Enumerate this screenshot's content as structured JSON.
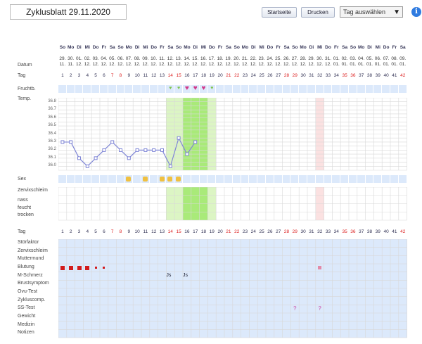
{
  "header": {
    "title": "Zyklusblatt 29.11.2020",
    "buttons": [
      "Startseite",
      "Drucken"
    ],
    "select_value": "Tag auswählen",
    "info_glyph": "i"
  },
  "labels": {
    "datum": "Datum",
    "tag": "Tag",
    "frucht": "Fruchtb.",
    "temp": "Temp.",
    "sex": "Sex",
    "zervix": "Zervixschleim",
    "zervix_levels": [
      "nass",
      "feucht",
      "trocken"
    ],
    "tag2": "Tag"
  },
  "temp_axis": [
    "36.8",
    "36.7",
    "36.6",
    "36.5",
    "36.4",
    "36.3",
    "36.2",
    "36.1",
    "36.0"
  ],
  "weekdays": [
    "So",
    "Mo",
    "Di",
    "Mi",
    "Do",
    "Fr",
    "Sa",
    "So",
    "Mo",
    "Di",
    "Mi",
    "Do",
    "Fr",
    "Sa",
    "So",
    "Mo",
    "Di",
    "Mi",
    "Do",
    "Fr",
    "Sa",
    "So",
    "Mo",
    "Di",
    "Mi",
    "Do",
    "Fr",
    "Sa",
    "So",
    "Mo",
    "Di",
    "Mi",
    "Do",
    "Fr",
    "Sa",
    "So",
    "Mo",
    "Di",
    "Mi",
    "Do",
    "Fr",
    "Sa"
  ],
  "dates_top": [
    "29.",
    "30.",
    "01.",
    "02.",
    "03.",
    "04.",
    "05.",
    "06.",
    "07.",
    "08.",
    "09.",
    "10.",
    "11.",
    "12.",
    "13.",
    "14.",
    "15.",
    "16.",
    "17.",
    "18.",
    "19.",
    "20.",
    "21.",
    "22.",
    "23.",
    "24.",
    "25.",
    "26.",
    "27.",
    "28.",
    "29.",
    "30.",
    "31.",
    "01.",
    "02.",
    "03.",
    "04.",
    "05.",
    "06.",
    "07.",
    "08.",
    "09."
  ],
  "dates_bottom": [
    "11.",
    "11.",
    "12.",
    "12.",
    "12.",
    "12.",
    "12.",
    "12.",
    "12.",
    "12.",
    "12.",
    "12.",
    "12.",
    "12.",
    "12.",
    "12.",
    "12.",
    "12.",
    "12.",
    "12.",
    "12.",
    "12.",
    "12.",
    "12.",
    "12.",
    "12.",
    "12.",
    "12.",
    "12.",
    "12.",
    "12.",
    "12.",
    "12.",
    "01.",
    "01.",
    "01.",
    "01.",
    "01.",
    "01.",
    "01.",
    "01.",
    "01."
  ],
  "day_numbers": [
    1,
    2,
    3,
    4,
    5,
    6,
    7,
    8,
    9,
    10,
    11,
    12,
    13,
    14,
    15,
    16,
    17,
    18,
    19,
    20,
    21,
    22,
    23,
    24,
    25,
    26,
    27,
    28,
    29,
    30,
    31,
    32,
    33,
    34,
    35,
    36,
    37,
    38,
    39,
    40,
    41,
    42
  ],
  "red_days": [
    7,
    8,
    14,
    15,
    21,
    22,
    28,
    29,
    35,
    36,
    42
  ],
  "temperatures": [
    36.3,
    36.3,
    36.1,
    36.0,
    36.1,
    36.2,
    36.3,
    36.2,
    36.1,
    36.2,
    36.2,
    36.2,
    36.2,
    36.0,
    36.35,
    36.15,
    36.3
  ],
  "fertile_hearts": {
    "14": "small",
    "15": "small",
    "16": "big",
    "17": "big",
    "18": "big",
    "19": "small"
  },
  "sex_days": [
    9,
    11,
    13,
    14,
    15
  ],
  "bottom_labels": [
    "Störfaktor",
    "Zervixschleim",
    "Muttermund",
    "Blutung",
    "M-Schmerz",
    "Brustsymptom",
    "Ovu-Test",
    "Zykluscomp.",
    "SS-Test",
    "Gewicht",
    "Medizin",
    "Notizen"
  ],
  "blutung_days": {
    "1": "big",
    "2": "big",
    "3": "big",
    "4": "big",
    "5": "small",
    "6": "small",
    "32": "pink"
  },
  "mschmerz": {
    "14": "Js",
    "16": "Js"
  },
  "sstest": {
    "29": "?",
    "32": "?"
  },
  "colors": {
    "green_light": "#dcf5c4",
    "green_dark": "#a9ea79",
    "pink": "#fbe1e1",
    "blue_cell": "#dce9fb",
    "line": "#7f86d6",
    "red": "#d22",
    "heart": "#d13a8c"
  }
}
